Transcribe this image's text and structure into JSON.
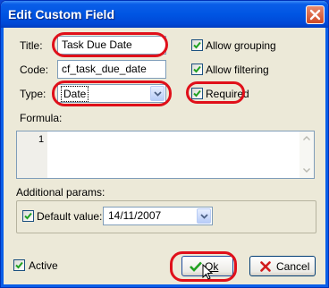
{
  "window": {
    "title": "Edit Custom Field",
    "close_icon": "close-icon"
  },
  "form": {
    "title_label": "Title:",
    "title_value": "Task Due Date",
    "code_label": "Code:",
    "code_value": "cf_task_due_date",
    "type_label": "Type:",
    "type_value": "Date",
    "formula_label": "Formula:",
    "formula_line_number": "1",
    "additional_params_label": "Additional params:"
  },
  "options": {
    "allow_grouping": {
      "label": "Allow grouping",
      "checked": true
    },
    "allow_filtering": {
      "label": "Allow filtering",
      "checked": true
    },
    "required": {
      "label": "Required",
      "checked": true
    }
  },
  "params": {
    "default_value_label": "Default value:",
    "default_value_checked": true,
    "default_value": "14/11/2007"
  },
  "footer": {
    "active_label": "Active",
    "active_checked": true,
    "ok_label": "Ok",
    "cancel_label": "Cancel"
  },
  "colors": {
    "titlebar": "#0055e3",
    "dialog_bg": "#ece9d8",
    "highlight": "#e0101a",
    "checkmark": "#21a121"
  }
}
